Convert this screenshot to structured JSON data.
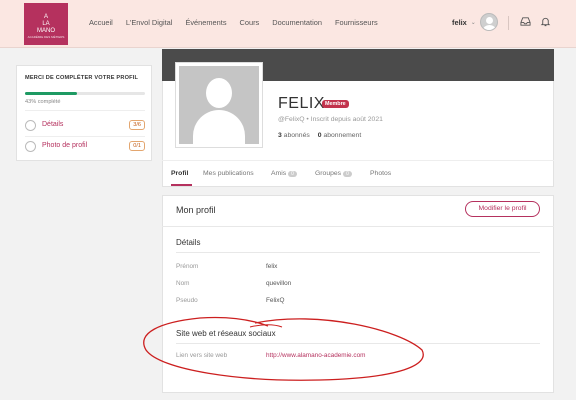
{
  "header": {
    "logo": {
      "line1": "A",
      "line2": "LA",
      "line3": "MANO",
      "tagline": "ACADÉMIE DES MÉTIERS"
    },
    "nav": [
      {
        "label": "Accueil"
      },
      {
        "label": "L'Envol Digital"
      },
      {
        "label": "Événements"
      },
      {
        "label": "Cours"
      },
      {
        "label": "Documentation"
      },
      {
        "label": "Fournisseurs"
      }
    ],
    "username": "felix",
    "icons": [
      "inbox-icon",
      "bell-icon"
    ]
  },
  "completion": {
    "title": "MERCI DE COMPLÉTER VOTRE PROFIL",
    "progress_fraction": 0.43,
    "percent_label": "43% complété",
    "items": [
      {
        "label": "Détails",
        "count": "3/6"
      },
      {
        "label": "Photo de profil",
        "count": "0/1"
      }
    ]
  },
  "profile": {
    "name": "FELIX",
    "badge": "Membre",
    "handle": "@FelixQ",
    "joined": " • Inscrit depuis août 2021",
    "followers_count": "3",
    "followers_label": "abonnés",
    "following_count": "0",
    "following_label": "abonnement"
  },
  "tabs": [
    {
      "label": "Profil",
      "active": true
    },
    {
      "label": "Mes publications"
    },
    {
      "label": "Amis",
      "count": "0"
    },
    {
      "label": "Groupes",
      "count": "0"
    },
    {
      "label": "Photos"
    }
  ],
  "main": {
    "title": "Mon profil",
    "edit_button": "Modifier le profil",
    "details_title": "Détails",
    "details": [
      {
        "label": "Prénom",
        "value": "felix"
      },
      {
        "label": "Nom",
        "value": "quevillon"
      },
      {
        "label": "Pseudo",
        "value": "FelixQ"
      }
    ],
    "social_title": "Site web et réseaux sociaux",
    "social": [
      {
        "label": "Lien vers site web",
        "value": "http://www.alamano-academie.com"
      }
    ]
  },
  "colors": {
    "brand": "#b5315e",
    "header_bg": "#fbe7e2",
    "progress": "#1e9a63",
    "annotation": "#cc1f1f"
  }
}
